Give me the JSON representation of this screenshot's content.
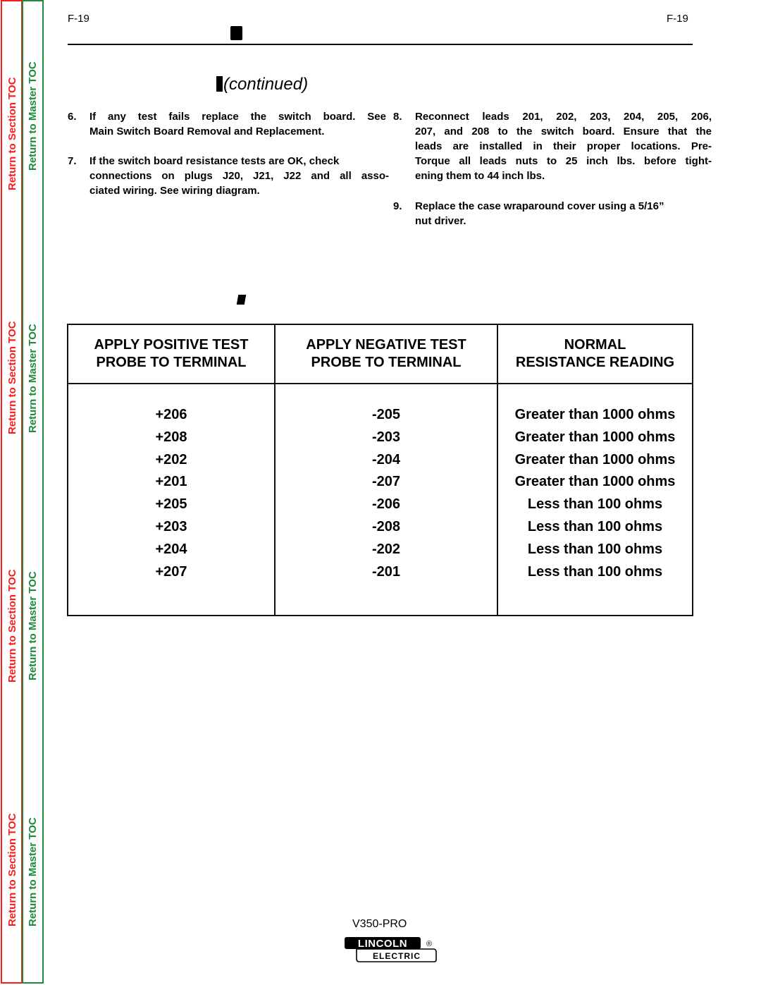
{
  "nav": {
    "section_toc_label": "Return to Section TOC",
    "master_toc_label": "Return to Master TOC",
    "colors": {
      "section": "#ff1a1a",
      "master": "#1e8a3a"
    }
  },
  "header": {
    "page_number_left": "F-19",
    "page_number_right": "F-19",
    "subtitle": "(continued)"
  },
  "steps": [
    {
      "number": "6.",
      "lines": [
        "If any test fails replace the switch board.  See",
        "Main Switch Board Removal and Replacement."
      ]
    },
    {
      "number": "7.",
      "lines": [
        "If the switch board resistance tests are OK, check",
        "connections on plugs J20, J21, J22 and all asso-",
        "ciated wiring.  See wiring diagram."
      ]
    },
    {
      "number": "8.",
      "lines": [
        "Reconnect leads 201, 202, 203, 204, 205, 206,",
        "207, and 208 to the switch board.  Ensure that the",
        "leads are installed in their proper locations.  Pre-",
        "Torque all leads nuts to 25 inch lbs. before tight-",
        "ening them to 44 inch lbs."
      ]
    },
    {
      "number": "9.",
      "lines": [
        "Replace the case wraparound cover using a 5/16”",
        "nut driver."
      ]
    }
  ],
  "table": {
    "headers": [
      [
        "APPLY POSITIVE TEST",
        "PROBE TO TERMINAL"
      ],
      [
        "APPLY NEGATIVE TEST",
        "PROBE TO TERMINAL"
      ],
      [
        "NORMAL",
        "RESISTANCE READING"
      ]
    ],
    "rows": [
      {
        "positive": "+206",
        "negative": "-205",
        "reading": "Greater than 1000 ohms"
      },
      {
        "positive": "+208",
        "negative": "-203",
        "reading": "Greater than 1000 ohms"
      },
      {
        "positive": "+202",
        "negative": "-204",
        "reading": "Greater than 1000 ohms"
      },
      {
        "positive": "+201",
        "negative": "-207",
        "reading": "Greater than 1000 ohms"
      },
      {
        "positive": "+205",
        "negative": "-206",
        "reading": "Less than 100 ohms"
      },
      {
        "positive": "+203",
        "negative": "-208",
        "reading": "Less than 100 ohms"
      },
      {
        "positive": "+204",
        "negative": "-202",
        "reading": "Less than 100 ohms"
      },
      {
        "positive": "+207",
        "negative": "-201",
        "reading": "Less than 100 ohms"
      }
    ]
  },
  "footer": {
    "model": "V350-PRO",
    "logo_top": "LINCOLN",
    "logo_bottom": "ELECTRIC",
    "logo_mark": "®"
  }
}
